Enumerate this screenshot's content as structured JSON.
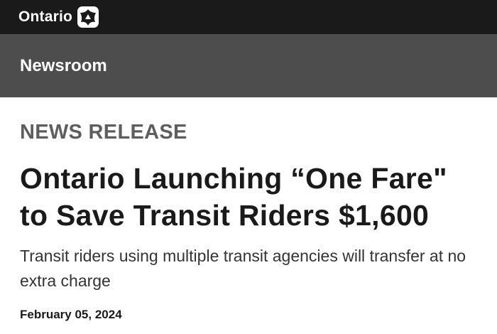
{
  "header": {
    "brand_text": "Ontario",
    "logo_icon": "ontario-trillium-logo",
    "bg_color": "#1a1a1a"
  },
  "subheader": {
    "title": "Newsroom",
    "bg_color": "#4d4d4d"
  },
  "article": {
    "kicker": "NEWS RELEASE",
    "headline": "Ontario Launching “One Fare\" to Save Transit Riders $1,600",
    "subheadline": "Transit riders using multiple transit agencies will transfer at no extra charge",
    "date": "February 05, 2024"
  }
}
